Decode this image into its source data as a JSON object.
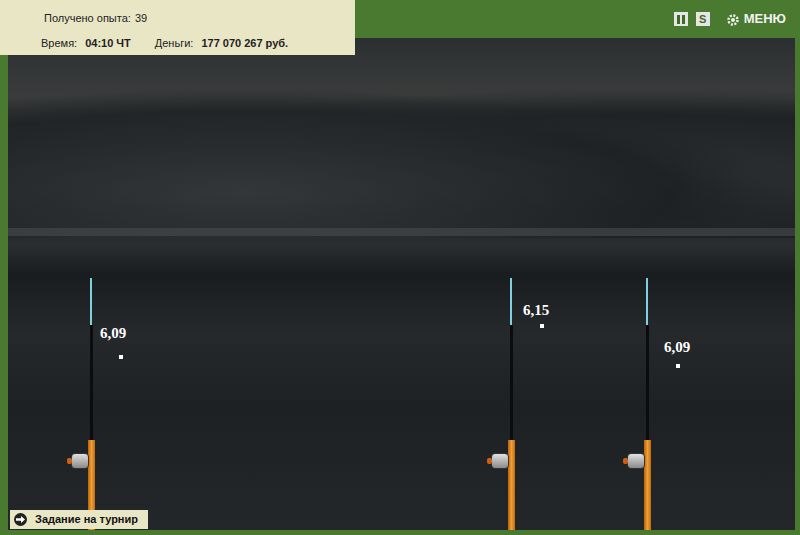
{
  "stats": {
    "experience": {
      "label": "Получено опыта:",
      "value": "39"
    },
    "time": {
      "label": "Время:",
      "value": "04:10 ЧТ"
    },
    "money": {
      "label": "Деньги:",
      "value": "177 070 267 руб."
    }
  },
  "toolbar": {
    "sound": "S",
    "menu": "МЕНЮ"
  },
  "rods": [
    {
      "reading": "6,09"
    },
    {
      "reading": "6,15"
    },
    {
      "reading": "6,09"
    }
  ],
  "task_button": {
    "label": "Задание на турнир"
  }
}
